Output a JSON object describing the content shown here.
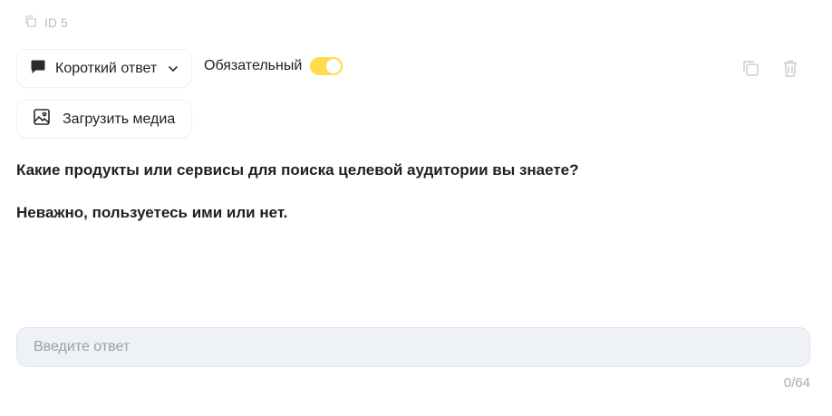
{
  "question_id": {
    "label": "ID 5",
    "icon": "copy-icon"
  },
  "toolbar": {
    "answer_type": {
      "label": "Короткий ответ",
      "icon": "comment-icon"
    },
    "required": {
      "label": "Обязательный",
      "enabled": true,
      "accent": "#ffdb4d"
    },
    "upload_media": {
      "label": "Загрузить медиа",
      "icon": "image-icon"
    },
    "actions": [
      {
        "name": "copy",
        "icon": "copy-icon"
      },
      {
        "name": "delete",
        "icon": "trash-icon"
      }
    ]
  },
  "question": {
    "line1": "Какие продукты или сервисы для поиска целевой аудитории вы знаете?",
    "line2": "Неважно, пользуетесь ими или нет."
  },
  "answer": {
    "placeholder": "Введите ответ",
    "value": "",
    "counter": "0/64"
  }
}
